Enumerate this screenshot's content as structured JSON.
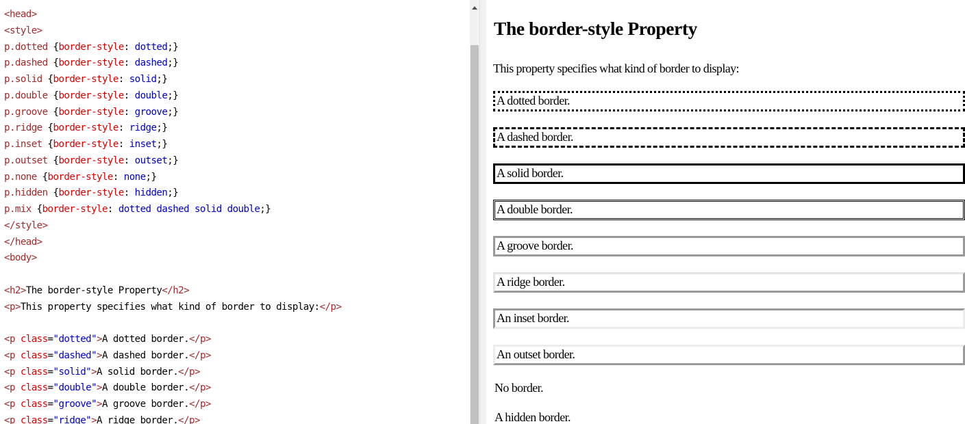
{
  "editor": {
    "lines": [
      {
        "row": 0,
        "parts": [
          {
            "c": "tag",
            "t": "<head>"
          }
        ]
      },
      {
        "row": 1,
        "parts": [
          {
            "c": "tag",
            "t": "<style>"
          }
        ]
      },
      {
        "row": 2,
        "parts": [
          {
            "c": "sel",
            "t": "p.dotted "
          },
          {
            "c": "txt",
            "t": "{"
          },
          {
            "c": "prop",
            "t": "border-style"
          },
          {
            "c": "txt",
            "t": ": "
          },
          {
            "c": "val",
            "t": "dotted"
          },
          {
            "c": "txt",
            "t": ";}"
          }
        ]
      },
      {
        "row": 3,
        "parts": [
          {
            "c": "sel",
            "t": "p.dashed "
          },
          {
            "c": "txt",
            "t": "{"
          },
          {
            "c": "prop",
            "t": "border-style"
          },
          {
            "c": "txt",
            "t": ": "
          },
          {
            "c": "val",
            "t": "dashed"
          },
          {
            "c": "txt",
            "t": ";}"
          }
        ]
      },
      {
        "row": 4,
        "parts": [
          {
            "c": "sel",
            "t": "p.solid "
          },
          {
            "c": "txt",
            "t": "{"
          },
          {
            "c": "prop",
            "t": "border-style"
          },
          {
            "c": "txt",
            "t": ": "
          },
          {
            "c": "val",
            "t": "solid"
          },
          {
            "c": "txt",
            "t": ";}"
          }
        ]
      },
      {
        "row": 5,
        "parts": [
          {
            "c": "sel",
            "t": "p.double "
          },
          {
            "c": "txt",
            "t": "{"
          },
          {
            "c": "prop",
            "t": "border-style"
          },
          {
            "c": "txt",
            "t": ": "
          },
          {
            "c": "val",
            "t": "double"
          },
          {
            "c": "txt",
            "t": ";}"
          }
        ]
      },
      {
        "row": 6,
        "parts": [
          {
            "c": "sel",
            "t": "p.groove "
          },
          {
            "c": "txt",
            "t": "{"
          },
          {
            "c": "prop",
            "t": "border-style"
          },
          {
            "c": "txt",
            "t": ": "
          },
          {
            "c": "val",
            "t": "groove"
          },
          {
            "c": "txt",
            "t": ";}"
          }
        ]
      },
      {
        "row": 7,
        "parts": [
          {
            "c": "sel",
            "t": "p.ridge "
          },
          {
            "c": "txt",
            "t": "{"
          },
          {
            "c": "prop",
            "t": "border-style"
          },
          {
            "c": "txt",
            "t": ": "
          },
          {
            "c": "val",
            "t": "ridge"
          },
          {
            "c": "txt",
            "t": ";}"
          }
        ]
      },
      {
        "row": 8,
        "parts": [
          {
            "c": "sel",
            "t": "p.inset "
          },
          {
            "c": "txt",
            "t": "{"
          },
          {
            "c": "prop",
            "t": "border-style"
          },
          {
            "c": "txt",
            "t": ": "
          },
          {
            "c": "val",
            "t": "inset"
          },
          {
            "c": "txt",
            "t": ";}"
          }
        ]
      },
      {
        "row": 9,
        "parts": [
          {
            "c": "sel",
            "t": "p.outset "
          },
          {
            "c": "txt",
            "t": "{"
          },
          {
            "c": "prop",
            "t": "border-style"
          },
          {
            "c": "txt",
            "t": ": "
          },
          {
            "c": "val",
            "t": "outset"
          },
          {
            "c": "txt",
            "t": ";}"
          }
        ]
      },
      {
        "row": 10,
        "parts": [
          {
            "c": "sel",
            "t": "p.none "
          },
          {
            "c": "txt",
            "t": "{"
          },
          {
            "c": "prop",
            "t": "border-style"
          },
          {
            "c": "txt",
            "t": ": "
          },
          {
            "c": "val",
            "t": "none"
          },
          {
            "c": "txt",
            "t": ";}"
          }
        ]
      },
      {
        "row": 11,
        "parts": [
          {
            "c": "sel",
            "t": "p.hidden "
          },
          {
            "c": "txt",
            "t": "{"
          },
          {
            "c": "prop",
            "t": "border-style"
          },
          {
            "c": "txt",
            "t": ": "
          },
          {
            "c": "val",
            "t": "hidden"
          },
          {
            "c": "txt",
            "t": ";}"
          }
        ]
      },
      {
        "row": 12,
        "parts": [
          {
            "c": "sel",
            "t": "p.mix "
          },
          {
            "c": "txt",
            "t": "{"
          },
          {
            "c": "prop",
            "t": "border-style"
          },
          {
            "c": "txt",
            "t": ": "
          },
          {
            "c": "val",
            "t": "dotted dashed solid double"
          },
          {
            "c": "txt",
            "t": ";}"
          }
        ]
      },
      {
        "row": 13,
        "parts": [
          {
            "c": "tag",
            "t": "</style>"
          }
        ]
      },
      {
        "row": 14,
        "parts": [
          {
            "c": "tag",
            "t": "</head>"
          }
        ]
      },
      {
        "row": 15,
        "parts": [
          {
            "c": "tag",
            "t": "<body>"
          }
        ]
      },
      {
        "row": 17,
        "parts": [
          {
            "c": "tag",
            "t": "<h2>"
          },
          {
            "c": "ptxt",
            "t": "The border-style Property"
          },
          {
            "c": "tag",
            "t": "</h2>"
          }
        ]
      },
      {
        "row": 18,
        "parts": [
          {
            "c": "tag",
            "t": "<p>"
          },
          {
            "c": "ptxt",
            "t": "This property specifies what kind of border to display:"
          },
          {
            "c": "tag",
            "t": "</p>"
          }
        ]
      },
      {
        "row": 20,
        "parts": [
          {
            "c": "tag",
            "t": "<p "
          },
          {
            "c": "attr",
            "t": "class"
          },
          {
            "c": "txt",
            "t": "="
          },
          {
            "c": "str",
            "t": "\"dotted\""
          },
          {
            "c": "tag",
            "t": ">"
          },
          {
            "c": "ptxt",
            "t": "A dotted border."
          },
          {
            "c": "tag",
            "t": "</p>"
          }
        ]
      },
      {
        "row": 21,
        "parts": [
          {
            "c": "tag",
            "t": "<p "
          },
          {
            "c": "attr",
            "t": "class"
          },
          {
            "c": "txt",
            "t": "="
          },
          {
            "c": "str",
            "t": "\"dashed\""
          },
          {
            "c": "tag",
            "t": ">"
          },
          {
            "c": "ptxt",
            "t": "A dashed border."
          },
          {
            "c": "tag",
            "t": "</p>"
          }
        ]
      },
      {
        "row": 22,
        "parts": [
          {
            "c": "tag",
            "t": "<p "
          },
          {
            "c": "attr",
            "t": "class"
          },
          {
            "c": "txt",
            "t": "="
          },
          {
            "c": "str",
            "t": "\"solid\""
          },
          {
            "c": "tag",
            "t": ">"
          },
          {
            "c": "ptxt",
            "t": "A solid border."
          },
          {
            "c": "tag",
            "t": "</p>"
          }
        ]
      },
      {
        "row": 23,
        "parts": [
          {
            "c": "tag",
            "t": "<p "
          },
          {
            "c": "attr",
            "t": "class"
          },
          {
            "c": "txt",
            "t": "="
          },
          {
            "c": "str",
            "t": "\"double\""
          },
          {
            "c": "tag",
            "t": ">"
          },
          {
            "c": "ptxt",
            "t": "A double border."
          },
          {
            "c": "tag",
            "t": "</p>"
          }
        ]
      },
      {
        "row": 24,
        "parts": [
          {
            "c": "tag",
            "t": "<p "
          },
          {
            "c": "attr",
            "t": "class"
          },
          {
            "c": "txt",
            "t": "="
          },
          {
            "c": "str",
            "t": "\"groove\""
          },
          {
            "c": "tag",
            "t": ">"
          },
          {
            "c": "ptxt",
            "t": "A groove border."
          },
          {
            "c": "tag",
            "t": "</p>"
          }
        ]
      },
      {
        "row": 25,
        "parts": [
          {
            "c": "tag",
            "t": "<p "
          },
          {
            "c": "attr",
            "t": "class"
          },
          {
            "c": "txt",
            "t": "="
          },
          {
            "c": "str",
            "t": "\"ridge\""
          },
          {
            "c": "tag",
            "t": ">"
          },
          {
            "c": "ptxt",
            "t": "A ridge border."
          },
          {
            "c": "tag",
            "t": "</p>"
          }
        ]
      }
    ]
  },
  "result": {
    "heading": "The border-style Property",
    "intro": "This property specifies what kind of border to display:",
    "paragraphs": {
      "dotted": "A dotted border.",
      "dashed": "A dashed border.",
      "solid": "A solid border.",
      "double": "A double border.",
      "groove": "A groove border.",
      "ridge": "A ridge border.",
      "inset": "An inset border.",
      "outset": "An outset border.",
      "none": "No border.",
      "hidden": "A hidden border."
    }
  }
}
